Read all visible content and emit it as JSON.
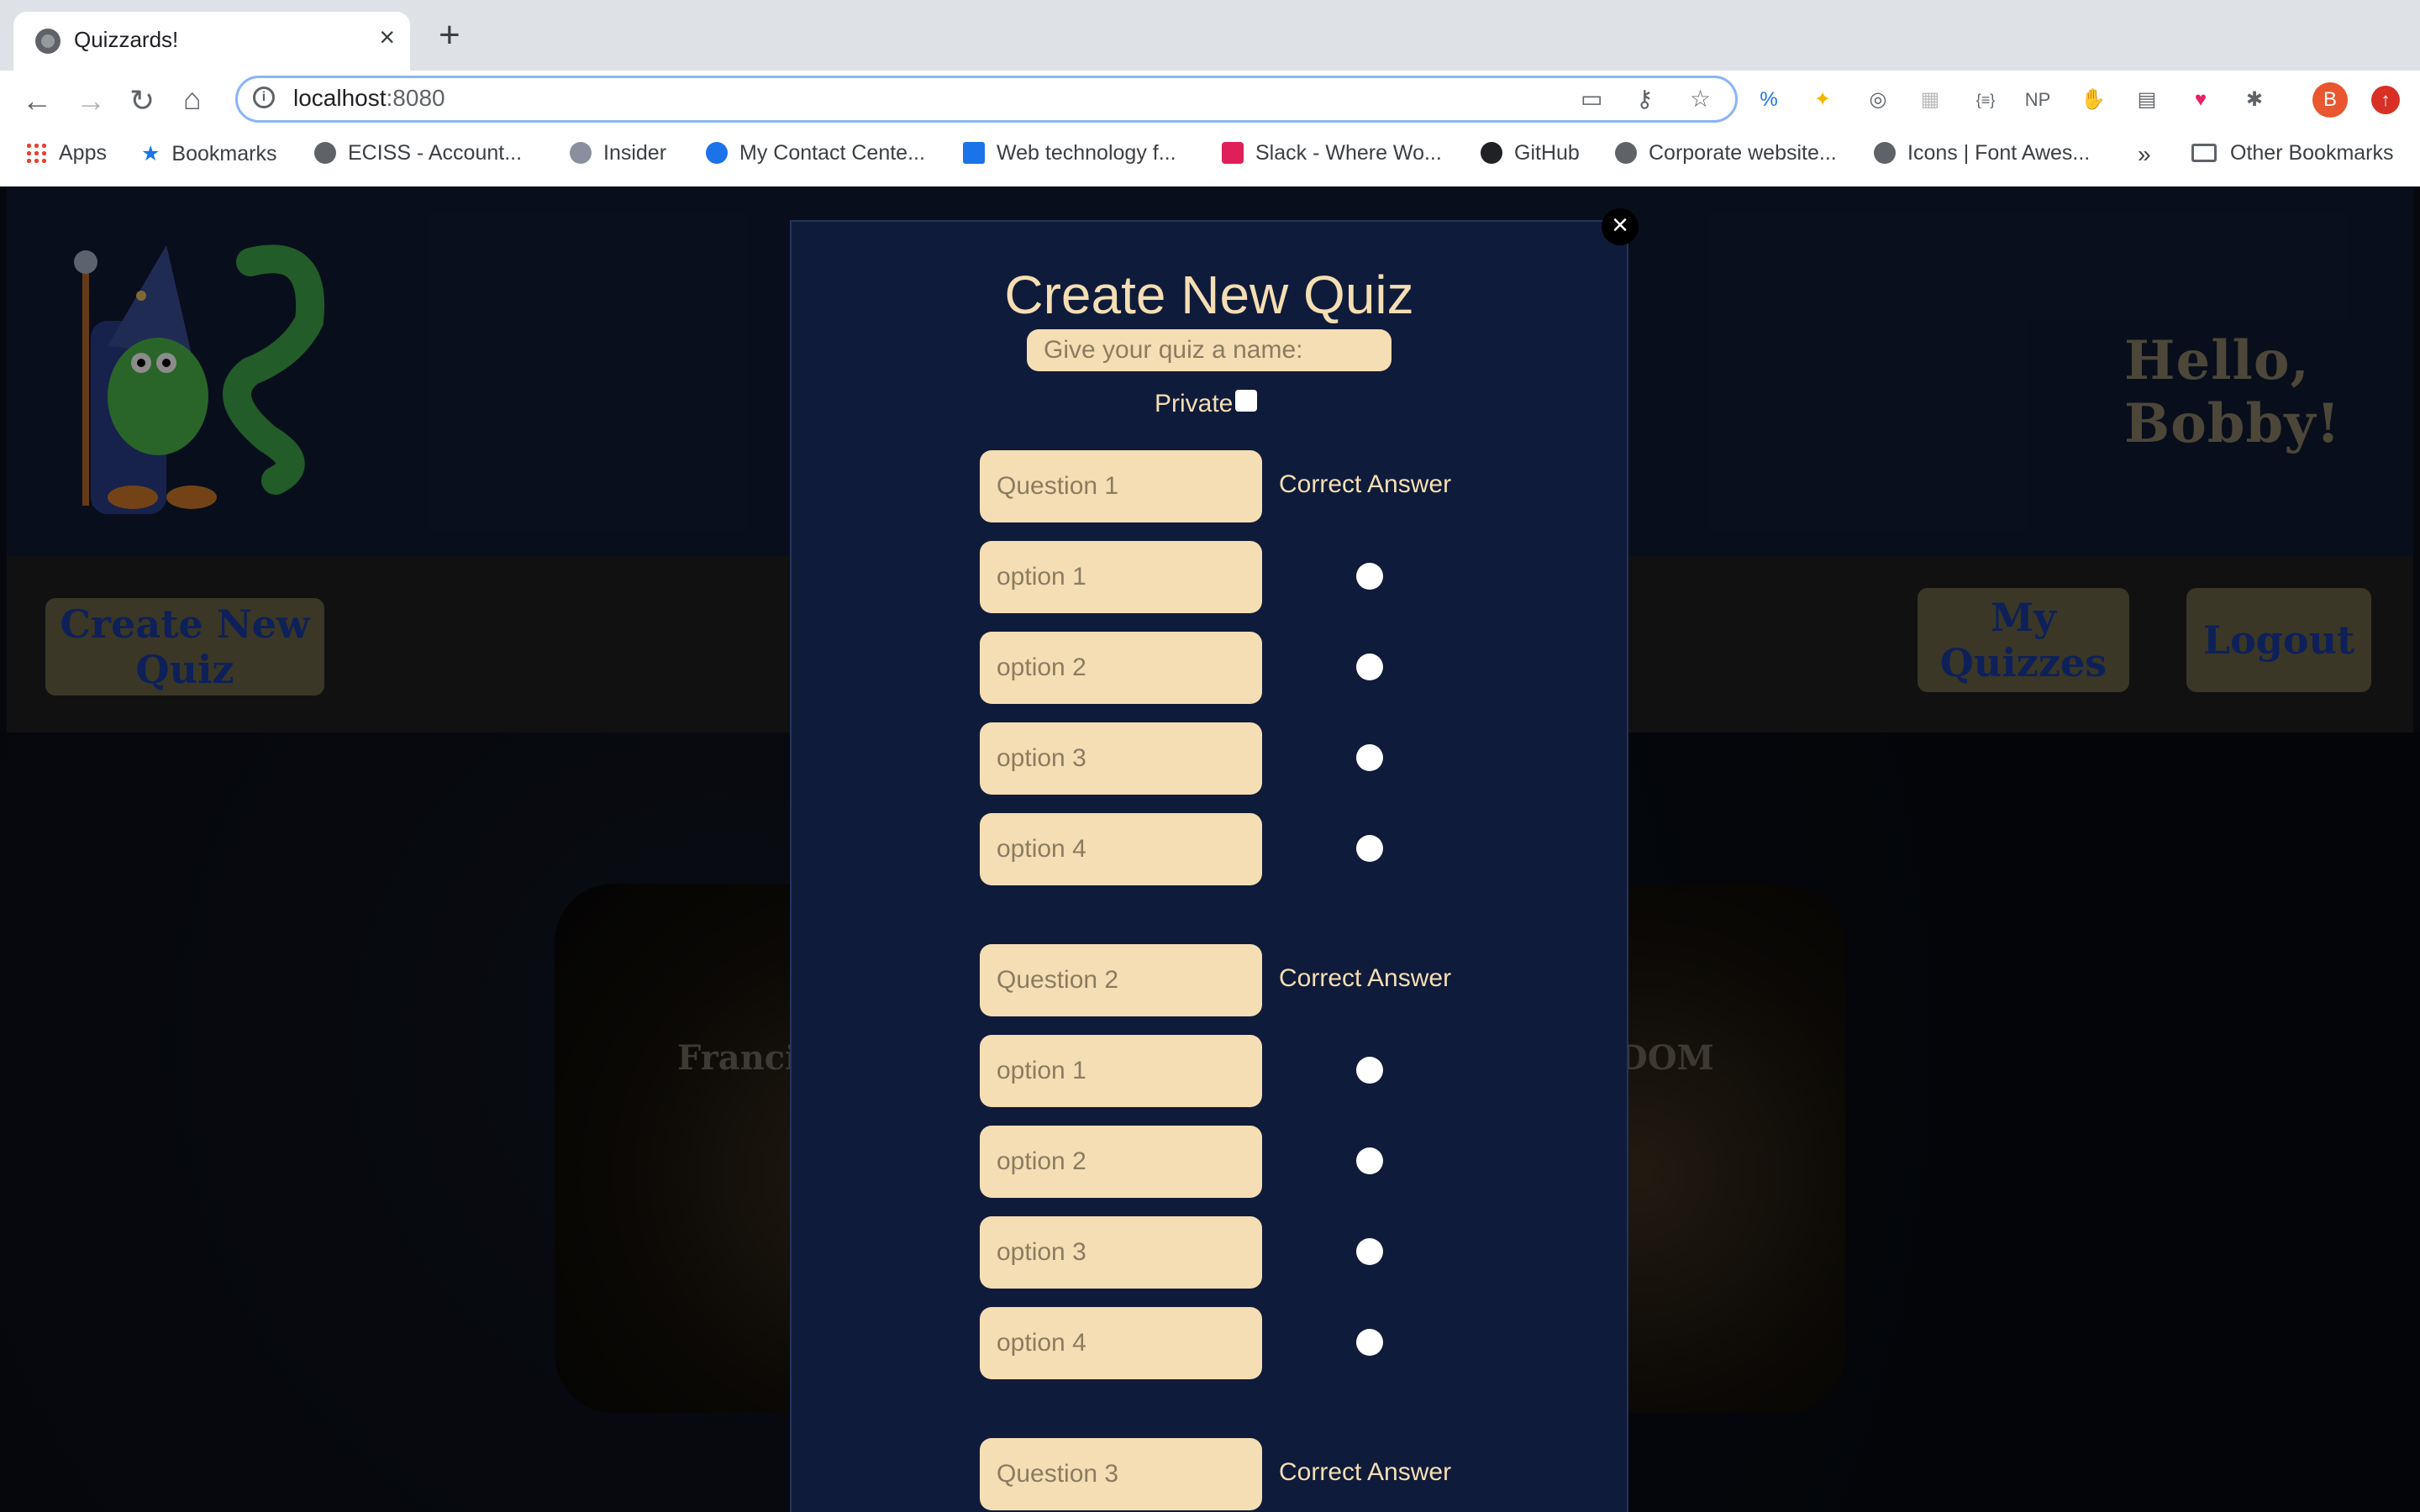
{
  "browser": {
    "tab_title": "Quizzards!",
    "tab_close": "×",
    "new_tab": "+",
    "url_host": "localhost",
    "url_port": ":8080",
    "avatar_letter": "B",
    "bookmarks": [
      {
        "label": "Apps",
        "icon": "apps-grid-icon"
      },
      {
        "label": "Bookmarks",
        "icon": "star-icon"
      },
      {
        "label": "ECISS - Account...",
        "icon": "globe-icon"
      },
      {
        "label": "Insider",
        "icon": "wordpress-icon"
      },
      {
        "label": "My Contact Cente...",
        "icon": "contact-icon"
      },
      {
        "label": "Web technology f...",
        "icon": "mdn-icon"
      },
      {
        "label": "Slack - Where Wo...",
        "icon": "slack-icon"
      },
      {
        "label": "GitHub",
        "icon": "github-icon"
      },
      {
        "label": "Corporate website...",
        "icon": "globe-icon"
      },
      {
        "label": "Icons | Font Awes...",
        "icon": "globe-icon"
      }
    ],
    "more_bookmarks": "»",
    "other_bookmarks": "Other Bookmarks"
  },
  "site": {
    "greeting": "Hello, Bobby!",
    "nav": {
      "create": "Create New Quiz",
      "my_quizzes": "My Quizzes",
      "logout": "Logout"
    },
    "cards": [
      "Francis Fe",
      "DOM"
    ]
  },
  "modal": {
    "close": "×",
    "title": "Create New Quiz",
    "name_placeholder": "Give your quiz a name:",
    "private_label": "Private",
    "correct_answer_label": "Correct Answer",
    "questions": [
      {
        "placeholder": "Question 1",
        "options": [
          "option 1",
          "option 2",
          "option 3",
          "option 4"
        ]
      },
      {
        "placeholder": "Question 2",
        "options": [
          "option 1",
          "option 2",
          "option 3",
          "option 4"
        ]
      },
      {
        "placeholder": "Question 3",
        "options": []
      }
    ]
  },
  "colors": {
    "modal_bg": "#0f1b3a",
    "field_bg": "#f5deb3",
    "header_bg": "#111b33",
    "nav_button_bg": "#6b6548",
    "nav_button_text": "#1a3ba0"
  }
}
